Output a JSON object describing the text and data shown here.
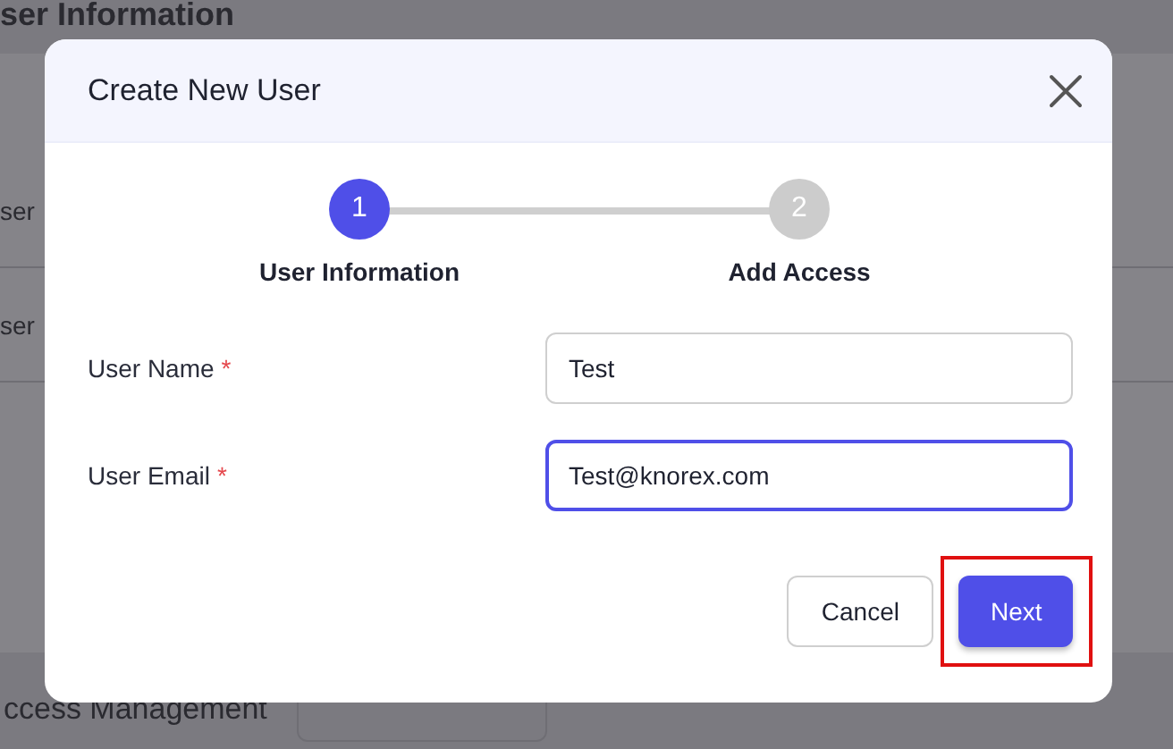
{
  "background": {
    "heading": "ser Information",
    "row_labels": [
      "ser",
      "ser"
    ],
    "section_title": "ccess Management"
  },
  "dialog": {
    "title": "Create New User",
    "steps": [
      {
        "number": "1",
        "label": "User Information",
        "selected": true
      },
      {
        "number": "2",
        "label": "Add Access",
        "selected": false
      }
    ],
    "fields": [
      {
        "label": "User Name",
        "required_mark": "*",
        "value": "Test",
        "focused": false
      },
      {
        "label": "User Email",
        "required_mark": "*",
        "value": "Test@knorex.com",
        "focused": true
      }
    ],
    "buttons": [
      {
        "label": "Cancel",
        "kind": "secondary",
        "highlighted": false
      },
      {
        "label": "Next",
        "kind": "primary",
        "highlighted": true
      }
    ]
  }
}
